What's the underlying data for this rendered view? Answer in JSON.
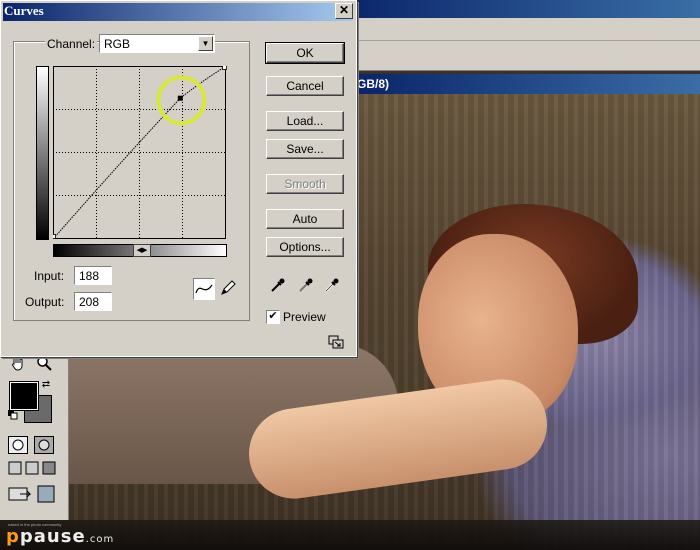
{
  "background_app": {
    "document_title": "GB/8)"
  },
  "watermark": {
    "logo_p": "p",
    "logo_rest": "pause",
    "logo_domain": ".com",
    "tagline": "naked in the photo community"
  },
  "curves_dialog": {
    "title": "Curves",
    "close_label": "✕",
    "channel_label": "Channel:",
    "channel_value": "RGB",
    "input_label": "Input:",
    "input_value": "188",
    "output_label": "Output:",
    "output_value": "208",
    "buttons": {
      "ok": "OK",
      "cancel": "Cancel",
      "load": "Load...",
      "save": "Save...",
      "smooth": "Smooth",
      "auto": "Auto",
      "options": "Options..."
    },
    "preview_label": "Preview",
    "preview_checked": true,
    "curve": {
      "points": [
        [
          0,
          0
        ],
        [
          188,
          208
        ],
        [
          255,
          255
        ]
      ],
      "selected_point": [
        188,
        208
      ],
      "range": [
        0,
        255
      ],
      "highlight_color": "#d8e83a"
    },
    "icons": {
      "curve_tool": "curve-tool-icon",
      "pencil_tool": "pencil-icon",
      "eyedropper_black": "eyedropper-black-icon",
      "eyedropper_gray": "eyedropper-gray-icon",
      "eyedropper_white": "eyedropper-white-icon",
      "expand": "expand-grid-icon"
    }
  },
  "toolbox": {
    "icons": [
      "hand-icon",
      "zoom-icon",
      "swap-colors-icon",
      "default-colors-icon",
      "standard-mode-icon",
      "quickmask-mode-icon",
      "screen-mode-icons",
      "jump-to-imageready-icon"
    ],
    "foreground_color": "#000000",
    "background_color": "#6a6a6a"
  }
}
